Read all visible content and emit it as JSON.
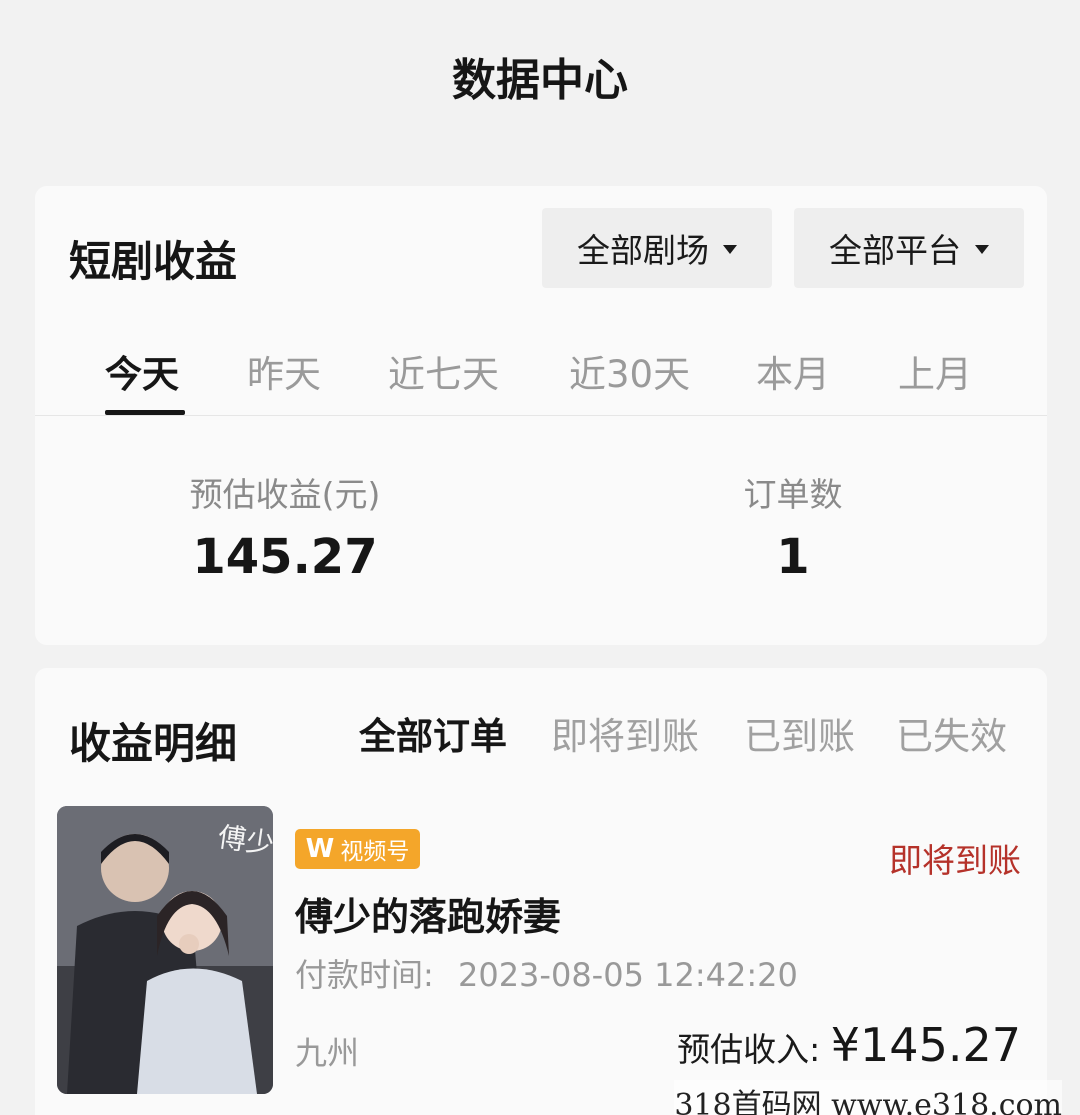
{
  "page": {
    "title": "数据中心"
  },
  "summary": {
    "title": "短剧收益",
    "dropdown_theater": "全部剧场",
    "dropdown_platform": "全部平台",
    "tabs": [
      "今天",
      "昨天",
      "近七天",
      "近30天",
      "本月",
      "上月"
    ],
    "active_tab": "今天",
    "estimated_label": "预估收益(元)",
    "estimated_value": "145.27",
    "orders_label": "订单数",
    "orders_value": "1"
  },
  "detail": {
    "title": "收益明细",
    "filters": [
      "全部订单",
      "即将到账",
      "已到账",
      "已失效"
    ],
    "active_filter": "全部订单",
    "order": {
      "platform_badge": "视频号",
      "status": "即将到账",
      "drama_title": "傅少的落跑娇妻",
      "pay_time_label": "付款时间:",
      "pay_time": "2023-08-05 12:42:20",
      "source": "九州",
      "income_label": "预估收入:",
      "income_value": "¥145.27",
      "status_color": "#b5322a",
      "badge_color": "#f4a62a"
    }
  },
  "watermark": "318首码网  www.e318.com"
}
